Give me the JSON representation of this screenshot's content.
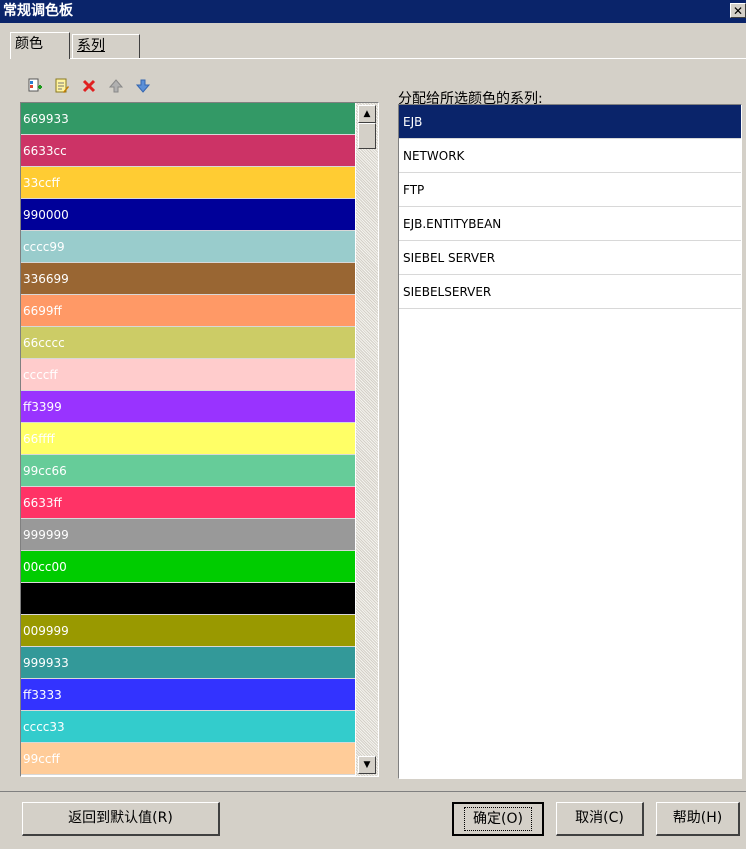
{
  "window": {
    "title": "常规调色板",
    "close_glyph": "✕"
  },
  "tabs": [
    {
      "label": "颜色"
    },
    {
      "label": "系列"
    }
  ],
  "toolbar": {
    "icons": [
      "add-color-icon",
      "edit-color-icon",
      "delete-icon",
      "move-up-icon",
      "move-down-icon"
    ]
  },
  "colors": [
    {
      "label": "669933",
      "color": "#339966"
    },
    {
      "label": "6633cc",
      "color": "#cc3366"
    },
    {
      "label": "33ccff",
      "color": "#ffcc33"
    },
    {
      "label": "990000",
      "color": "#000099"
    },
    {
      "label": "cccc99",
      "color": "#99cccc"
    },
    {
      "label": "336699",
      "color": "#996633"
    },
    {
      "label": "6699ff",
      "color": "#ff9966"
    },
    {
      "label": "66cccc",
      "color": "#cccc66"
    },
    {
      "label": "ccccff",
      "color": "#ffcccc"
    },
    {
      "label": "ff3399",
      "color": "#9933ff"
    },
    {
      "label": "66ffff",
      "color": "#ffff66"
    },
    {
      "label": "99cc66",
      "color": "#66cc99"
    },
    {
      "label": "6633ff",
      "color": "#ff3366"
    },
    {
      "label": "999999",
      "color": "#999999"
    },
    {
      "label": "00cc00",
      "color": "#00cc00"
    },
    {
      "label": "",
      "color": "#000000"
    },
    {
      "label": "009999",
      "color": "#999900"
    },
    {
      "label": "999933",
      "color": "#339999"
    },
    {
      "label": "ff3333",
      "color": "#3333ff"
    },
    {
      "label": "cccc33",
      "color": "#33cccc"
    },
    {
      "label": "99ccff",
      "color": "#ffcc99"
    }
  ],
  "series_panel": {
    "label": "分配给所选颜色的系列:",
    "items": [
      "EJB",
      "NETWORK",
      "FTP",
      "EJB.ENTITYBEAN",
      "SIEBEL SERVER",
      "SIEBELSERVER"
    ],
    "selected_index": 0
  },
  "buttons": {
    "reset": "返回到默认值(R)",
    "ok": "确定(O)",
    "cancel": "取消(C)",
    "help": "帮助(H)"
  }
}
